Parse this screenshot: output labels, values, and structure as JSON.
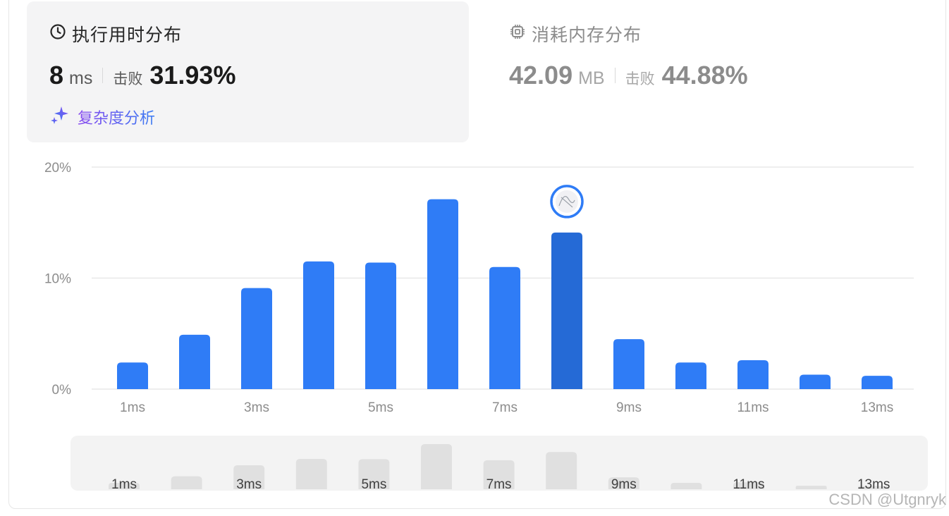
{
  "runtime": {
    "title": "执行用时分布",
    "value": "8",
    "unit": "ms",
    "beat_label": "击败",
    "beat_value": "31.93%",
    "complexity_link": "复杂度分析"
  },
  "memory": {
    "title": "消耗内存分布",
    "value": "42.09",
    "unit": "MB",
    "beat_label": "击败",
    "beat_value": "44.88%"
  },
  "colors": {
    "bar": "#2f7cf6",
    "bar_selected": "#256ad6",
    "grid": "#e8e8e8",
    "mini_bar": "#e0e0e0",
    "mini_bg": "#f3f3f3"
  },
  "icons": {
    "runtime": "clock-icon",
    "memory": "chip-icon",
    "complexity": "sparkle-icon",
    "selected_marker": "avatar"
  },
  "chart_data": {
    "type": "bar",
    "categories": [
      "1ms",
      "2ms",
      "3ms",
      "4ms",
      "5ms",
      "6ms",
      "7ms",
      "8ms",
      "9ms",
      "10ms",
      "11ms",
      "12ms",
      "13ms"
    ],
    "values": [
      2.4,
      4.9,
      9.1,
      11.5,
      11.4,
      17.1,
      11.0,
      14.1,
      4.5,
      2.4,
      2.6,
      1.3,
      1.2
    ],
    "selected_category": "8ms",
    "y_ticks": [
      "0%",
      "10%",
      "20%"
    ],
    "x_tick_labels": [
      "1ms",
      "3ms",
      "5ms",
      "7ms",
      "9ms",
      "11ms",
      "13ms"
    ],
    "ylim": [
      0,
      20
    ],
    "grid": true,
    "title": "",
    "xlabel": "",
    "ylabel": ""
  },
  "watermark": "CSDN @Utgnryk"
}
